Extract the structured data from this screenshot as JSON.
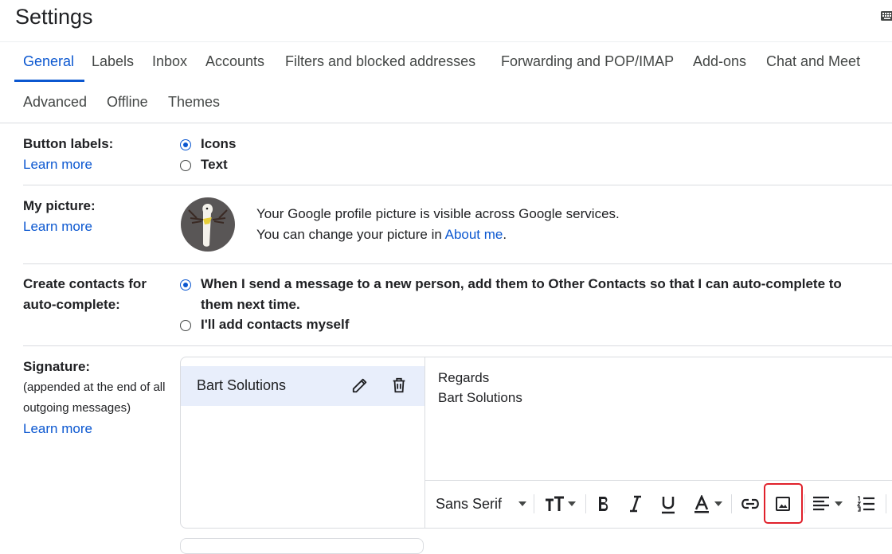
{
  "header": {
    "title": "Settings"
  },
  "tabs": [
    {
      "label": "General",
      "active": true
    },
    {
      "label": "Labels"
    },
    {
      "label": "Inbox"
    },
    {
      "label": "Accounts"
    },
    {
      "label": "Filters and blocked addresses"
    },
    {
      "label": "Forwarding and POP/IMAP"
    },
    {
      "label": "Add-ons"
    },
    {
      "label": "Chat and Meet"
    },
    {
      "label": "Advanced"
    },
    {
      "label": "Offline"
    },
    {
      "label": "Themes"
    }
  ],
  "button_labels": {
    "label": "Button labels:",
    "learn_more": "Learn more",
    "options": [
      "Icons",
      "Text"
    ],
    "selected": "Icons"
  },
  "my_picture": {
    "label": "My picture:",
    "learn_more": "Learn more",
    "line1": "Your Google profile picture is visible across Google services.",
    "line2_prefix": "You can change your picture in ",
    "line2_link": "About me",
    "line2_suffix": "."
  },
  "create_contacts": {
    "label_line1": "Create contacts for",
    "label_line2": "auto-complete:",
    "option1_line1": "When I send a message to a new person, add them to Other Contacts so that I can auto-complete to",
    "option1_line2": "them next time.",
    "option2": "I'll add contacts myself",
    "selected": "option1"
  },
  "signature": {
    "label": "Signature:",
    "sub_line1": "(appended at the end of all",
    "sub_line2": "outgoing messages)",
    "learn_more": "Learn more",
    "name": "Bart Solutions",
    "content": [
      "Regards",
      "Bart Solutions"
    ]
  },
  "toolbar": {
    "font": "Sans Serif",
    "icons": [
      "text-size-icon",
      "bold-icon",
      "italic-icon",
      "underline-icon",
      "text-color-icon",
      "link-icon",
      "insert-image-icon",
      "align-icon",
      "numbered-list-icon"
    ],
    "highlighted": "insert-image-icon",
    "highlight_color": "#e0212b",
    "accent_color": "#0b57d0"
  }
}
